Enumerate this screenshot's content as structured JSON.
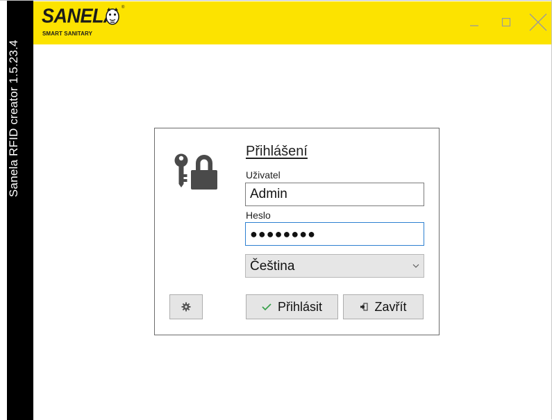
{
  "app": {
    "window_title": "Sanela RFID creator 1.5.23.4",
    "logo": {
      "brand": "SANELA",
      "tagline": "SMART SANITARY",
      "registered": "®"
    },
    "window_controls": {
      "minimize": "_",
      "maximize": "□",
      "close": "×"
    }
  },
  "login_dialog": {
    "title": "Přihlášení",
    "user_label": "Uživatel",
    "user_value": "Admin",
    "password_label": "Heslo",
    "password_value": "●●●●●●●●",
    "language": {
      "selected": "Čeština"
    },
    "buttons": {
      "settings_icon": "gear-icon",
      "login_label": "Přihlásit",
      "login_icon": "checkmark-icon",
      "close_label": "Zavřít",
      "close_icon": "exit-icon"
    }
  },
  "colors": {
    "titlebar": "#fce300",
    "sidebar": "#000000",
    "lock_icon": "#4a4a4a",
    "checkmark": "#3aa14c",
    "focus_border": "#2c7fd0"
  }
}
